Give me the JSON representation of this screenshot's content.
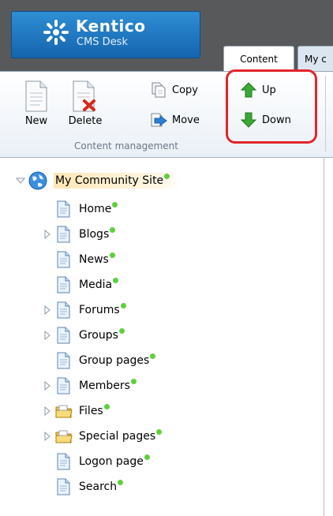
{
  "header": {
    "logo_name": "Kentico",
    "logo_sub": "CMS Desk",
    "tabs": [
      {
        "label": "Content",
        "active": true
      },
      {
        "label": "My c",
        "active": false
      }
    ]
  },
  "ribbon": {
    "new_label": "New",
    "delete_label": "Delete",
    "copy_label": "Copy",
    "move_label": "Move",
    "up_label": "Up",
    "down_label": "Down",
    "group_label": "Content management"
  },
  "tree": {
    "root": "My Community Site",
    "items": [
      {
        "label": "Home",
        "icon": "page-icon",
        "expandable": false
      },
      {
        "label": "Blogs",
        "icon": "page-icon",
        "expandable": true
      },
      {
        "label": "News",
        "icon": "page-icon",
        "expandable": false
      },
      {
        "label": "Media",
        "icon": "page-icon",
        "expandable": false
      },
      {
        "label": "Forums",
        "icon": "page-icon",
        "expandable": true
      },
      {
        "label": "Groups",
        "icon": "page-icon",
        "expandable": true
      },
      {
        "label": "Group pages",
        "icon": "page-icon",
        "expandable": false
      },
      {
        "label": "Members",
        "icon": "page-icon",
        "expandable": true
      },
      {
        "label": "Files",
        "icon": "folder-icon",
        "expandable": true
      },
      {
        "label": "Special pages",
        "icon": "folder-icon",
        "expandable": true
      },
      {
        "label": "Logon page",
        "icon": "page-icon",
        "expandable": false
      },
      {
        "label": "Search",
        "icon": "page-icon",
        "expandable": false
      }
    ]
  },
  "colors": {
    "header_bg": "#58595b",
    "logo_blue": "#1f78c1",
    "highlight_red": "#e3242b",
    "status_green": "#5fcf3e",
    "arrow_green": "#3aa935"
  }
}
